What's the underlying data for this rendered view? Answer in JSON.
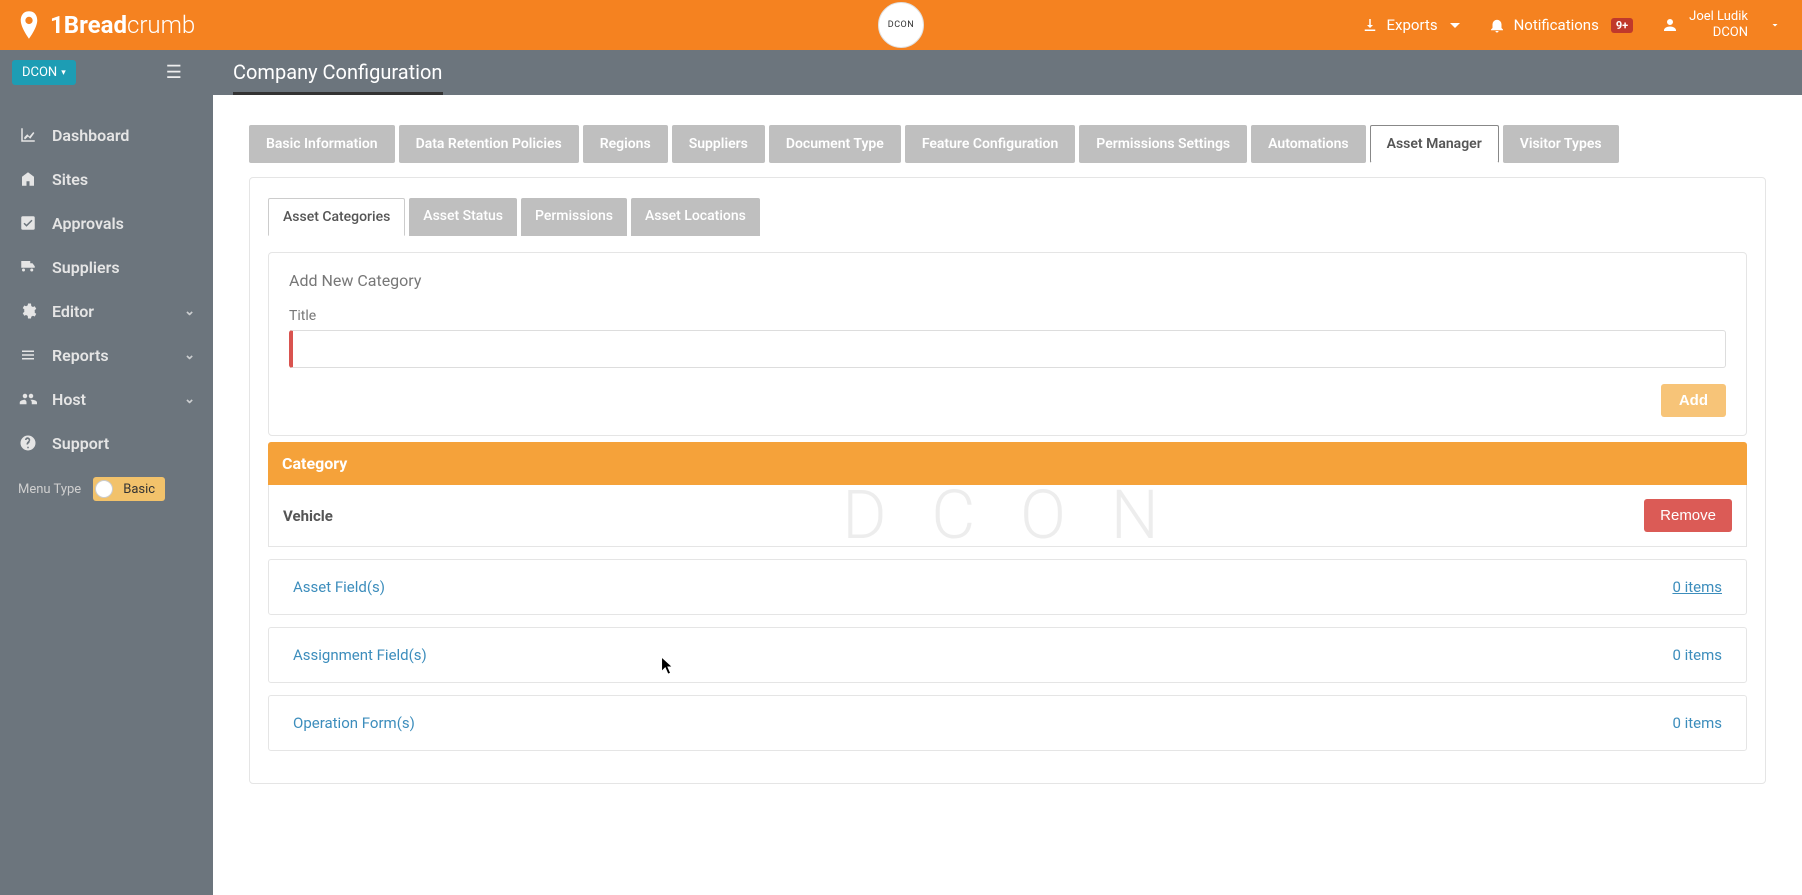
{
  "brand": {
    "bold": "1Bread",
    "thin": "crumb"
  },
  "center_logo": {
    "text": "DCON"
  },
  "header": {
    "exports_label": "Exports",
    "notifications_label": "Notifications",
    "notifications_badge": "9+",
    "user_name": "Joel Ludik",
    "user_company": "DCON"
  },
  "subbar": {
    "company_pill": "DCON",
    "page_title": "Company Configuration"
  },
  "sidebar": {
    "items": [
      {
        "label": "Dashboard",
        "icon": "chart-line-icon",
        "expandable": false
      },
      {
        "label": "Sites",
        "icon": "building-icon",
        "expandable": false
      },
      {
        "label": "Approvals",
        "icon": "check-square-icon",
        "expandable": false
      },
      {
        "label": "Suppliers",
        "icon": "truck-icon",
        "expandable": false
      },
      {
        "label": "Editor",
        "icon": "gear-icon",
        "expandable": true
      },
      {
        "label": "Reports",
        "icon": "list-icon",
        "expandable": true
      },
      {
        "label": "Host",
        "icon": "users-icon",
        "expandable": true
      },
      {
        "label": "Support",
        "icon": "question-icon",
        "expandable": false
      }
    ],
    "menu_type_label": "Menu Type",
    "menu_type_value": "Basic"
  },
  "tabs": [
    {
      "label": "Basic Information",
      "active": false
    },
    {
      "label": "Data Retention Policies",
      "active": false
    },
    {
      "label": "Regions",
      "active": false
    },
    {
      "label": "Suppliers",
      "active": false
    },
    {
      "label": "Document Type",
      "active": false
    },
    {
      "label": "Feature Configuration",
      "active": false
    },
    {
      "label": "Permissions Settings",
      "active": false
    },
    {
      "label": "Automations",
      "active": false
    },
    {
      "label": "Asset Manager",
      "active": true
    },
    {
      "label": "Visitor Types",
      "active": false
    }
  ],
  "subtabs": [
    {
      "label": "Asset Categories",
      "active": true
    },
    {
      "label": "Asset Status",
      "active": false
    },
    {
      "label": "Permissions",
      "active": false
    },
    {
      "label": "Asset Locations",
      "active": false
    }
  ],
  "add_category": {
    "heading": "Add New Category",
    "title_label": "Title",
    "title_value": "",
    "add_button": "Add"
  },
  "category_section": {
    "header": "Category",
    "name": "Vehicle",
    "remove_button": "Remove",
    "rows": [
      {
        "label": "Asset Field(s)",
        "count_label": "0 items",
        "underlined": true
      },
      {
        "label": "Assignment Field(s)",
        "count_label": "0 items",
        "underlined": false
      },
      {
        "label": "Operation Form(s)",
        "count_label": "0 items",
        "underlined": false
      }
    ]
  },
  "watermark_text": "D C O N"
}
